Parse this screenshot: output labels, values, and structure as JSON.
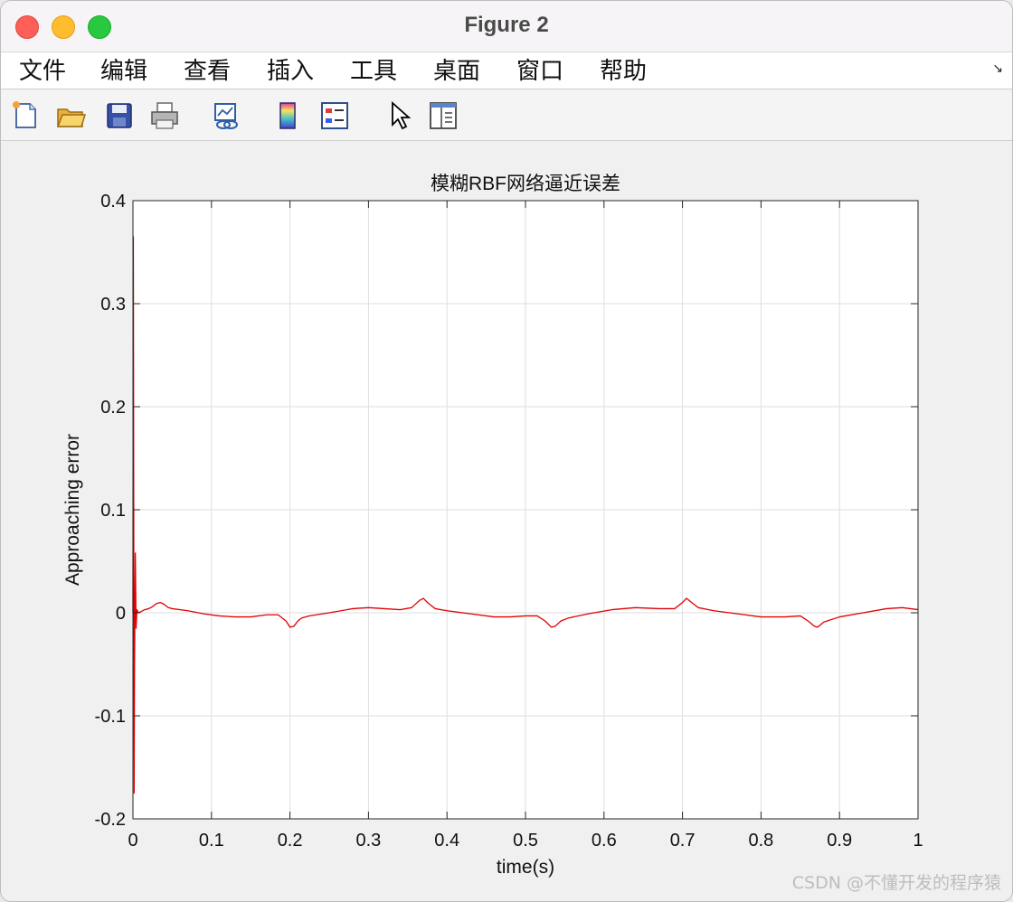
{
  "window": {
    "title": "Figure 2"
  },
  "menu": {
    "items": [
      "文件",
      "编辑",
      "查看",
      "插入",
      "工具",
      "桌面",
      "窗口",
      "帮助"
    ]
  },
  "toolbar": {
    "icons": [
      "new-figure-icon",
      "open-file-icon",
      "save-icon",
      "print-icon",
      "link-plot-icon",
      "colorbar-icon",
      "legend-icon",
      "edit-plot-arrow-icon",
      "property-inspector-icon"
    ]
  },
  "chart_data": {
    "type": "line",
    "title": "模糊RBF网络逼近误差",
    "xlabel": "time(s)",
    "ylabel": "Approaching error",
    "xlim": [
      0,
      1
    ],
    "ylim": [
      -0.2,
      0.4
    ],
    "xticks": [
      0,
      0.1,
      0.2,
      0.3,
      0.4,
      0.5,
      0.6,
      0.7,
      0.8,
      0.9,
      1
    ],
    "xtick_labels": [
      "0",
      "0.1",
      "0.2",
      "0.3",
      "0.4",
      "0.5",
      "0.6",
      "0.7",
      "0.8",
      "0.9",
      "1"
    ],
    "yticks": [
      -0.2,
      -0.1,
      0,
      0.1,
      0.2,
      0.3,
      0.4
    ],
    "ytick_labels": [
      "-0.2",
      "-0.1",
      "0",
      "0.1",
      "0.2",
      "0.3",
      "0.4"
    ],
    "grid": true,
    "series": [
      {
        "color": "#e00000",
        "x": [
          0,
          0.0005,
          0.001,
          0.0015,
          0.002,
          0.003,
          0.004,
          0.005,
          0.007,
          0.01,
          0.015,
          0.02,
          0.025,
          0.03,
          0.035,
          0.04,
          0.045,
          0.05,
          0.07,
          0.09,
          0.11,
          0.13,
          0.15,
          0.17,
          0.185,
          0.195,
          0.2,
          0.205,
          0.21,
          0.215,
          0.225,
          0.25,
          0.28,
          0.3,
          0.32,
          0.34,
          0.355,
          0.365,
          0.37,
          0.375,
          0.385,
          0.4,
          0.43,
          0.46,
          0.48,
          0.5,
          0.515,
          0.525,
          0.533,
          0.538,
          0.545,
          0.555,
          0.58,
          0.61,
          0.64,
          0.67,
          0.69,
          0.7,
          0.705,
          0.71,
          0.72,
          0.74,
          0.77,
          0.8,
          0.83,
          0.85,
          0.86,
          0.868,
          0.872,
          0.88,
          0.9,
          0.93,
          0.96,
          0.98,
          1.0
        ],
        "y": [
          0.0,
          0.365,
          0.1,
          -0.175,
          -0.05,
          0.058,
          -0.015,
          0.003,
          0.0,
          0.001,
          0.003,
          0.004,
          0.006,
          0.009,
          0.01,
          0.008,
          0.005,
          0.004,
          0.002,
          -0.001,
          -0.003,
          -0.004,
          -0.004,
          -0.002,
          -0.002,
          -0.008,
          -0.014,
          -0.013,
          -0.008,
          -0.005,
          -0.003,
          0.0,
          0.004,
          0.005,
          0.004,
          0.003,
          0.005,
          0.012,
          0.014,
          0.01,
          0.004,
          0.002,
          -0.001,
          -0.004,
          -0.004,
          -0.003,
          -0.003,
          -0.008,
          -0.014,
          -0.013,
          -0.008,
          -0.005,
          -0.001,
          0.003,
          0.005,
          0.004,
          0.004,
          0.01,
          0.014,
          0.011,
          0.005,
          0.002,
          -0.001,
          -0.004,
          -0.004,
          -0.003,
          -0.008,
          -0.013,
          -0.014,
          -0.009,
          -0.004,
          0.0,
          0.004,
          0.005,
          0.003
        ]
      }
    ]
  },
  "watermark": "CSDN @不懂开发的程序猿"
}
